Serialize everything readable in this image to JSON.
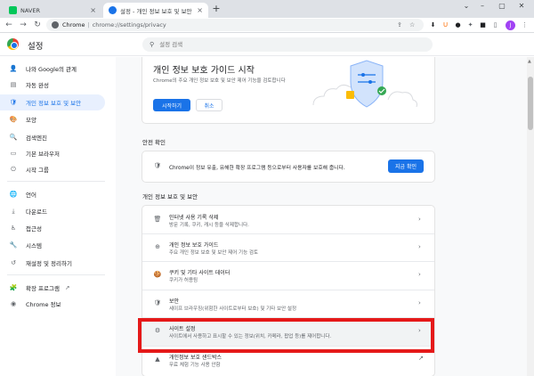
{
  "tabs": [
    {
      "label": "NAVER",
      "favicon_color": "#03c75a"
    },
    {
      "label": "설정 - 개인 정보 보호 및 보안",
      "favicon_color": "#1a73e8"
    }
  ],
  "window_controls": {
    "minimize": "–",
    "maximize": "▢",
    "close": "✕"
  },
  "toolbar": {
    "back": "←",
    "forward": "→",
    "reload": "↻",
    "address_scheme": "Chrome",
    "address_path": "chrome://settings/privacy",
    "profile_initial": "J"
  },
  "header": {
    "title": "설정",
    "search_placeholder": "설정 검색"
  },
  "sidebar": {
    "items": [
      {
        "label": "나와 Google의 관계",
        "icon": "👤"
      },
      {
        "label": "자동 완성",
        "icon": "▤"
      },
      {
        "label": "개인 정보 보호 및 보안",
        "icon": "🛡",
        "active": true
      },
      {
        "label": "모양",
        "icon": "🎨"
      },
      {
        "label": "검색엔진",
        "icon": "🔍"
      },
      {
        "label": "기본 브라우저",
        "icon": "▭"
      },
      {
        "label": "시작 그룹",
        "icon": "⏻"
      },
      {
        "label": "언어",
        "icon": "🌐"
      },
      {
        "label": "다운로드",
        "icon": "⤓"
      },
      {
        "label": "접근성",
        "icon": "♿"
      },
      {
        "label": "시스템",
        "icon": "🔧"
      },
      {
        "label": "재설정 및 정리하기",
        "icon": "↺"
      },
      {
        "label": "확장 프로그램",
        "icon": "🧩",
        "external": "↗"
      },
      {
        "label": "Chrome 정보",
        "icon": "◉"
      }
    ]
  },
  "guide": {
    "title": "개인 정보 보호 가이드 시작",
    "desc": "Chrome의 주요 개인 정보 보호 및 보안 제어 기능을 검토합니다",
    "start_label": "시작하기",
    "cancel_label": "취소"
  },
  "safety": {
    "section_title": "안전 확인",
    "text": "Chrome이 정보 유출, 유해한 확장 프로그램 등으로부터 사용자를 보호해 줍니다.",
    "button_label": "지금 확인"
  },
  "privacy": {
    "section_title": "개인 정보 보호 및 보안",
    "rows": [
      {
        "title": "인터넷 사용 기록 삭제",
        "sub": "방문 기록, 쿠키, 캐시 등을 삭제합니다.",
        "icon": "🗑"
      },
      {
        "title": "개인 정보 보호 가이드",
        "sub": "주요 개인 정보 보호 및 보안 제어 기능 검토",
        "icon": "⊕"
      },
      {
        "title": "쿠키 및 기타 사이트 데이터",
        "sub": "쿠키가 허용됨",
        "icon": "🍪"
      },
      {
        "title": "보안",
        "sub": "세이프 브라우징(위험한 사이트로부터 보호) 및 기타 보안 설정",
        "icon": "🛡"
      },
      {
        "title": "사이트 설정",
        "sub": "사이트에서 사용하고 표시할 수 있는 정보(위치, 카메라, 팝업 등)를 제어합니다.",
        "icon": "⚙"
      },
      {
        "title": "개인정보 보호 샌드박스",
        "sub": "무료 체험 기능 사용 안함",
        "icon": "▲"
      }
    ]
  },
  "colors": {
    "accent": "#1a73e8",
    "highlight": "#e51919"
  }
}
